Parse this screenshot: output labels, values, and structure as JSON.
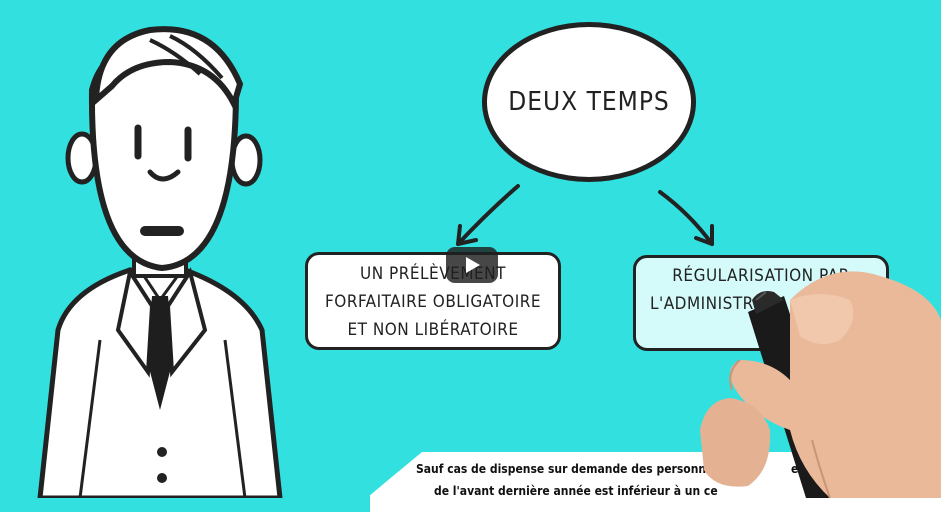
{
  "bubble": {
    "label": "DEUX TEMPS"
  },
  "left_box": {
    "line1": "UN PRÉLÈVEMENT",
    "line2": "FORFAITAIRE OBLIGATOIRE",
    "line3": "ET NON LIBÉRATOIRE"
  },
  "right_box": {
    "line1": "RÉGULARISATION PAR",
    "line2": "L'ADMINISTR"
  },
  "note": {
    "line1": "Sauf cas de dispense sur demande des personne",
    "line1_tail": "e",
    "line2": "de l'avant dernière année est inférieur à un ce"
  },
  "icons": {
    "play": "play-button-icon",
    "character": "businessman-illustration",
    "hand": "hand-with-marker-illustration"
  },
  "colors": {
    "background": "#33e0e0",
    "ink": "#222222",
    "right_box_fill": "#d4fafa"
  }
}
